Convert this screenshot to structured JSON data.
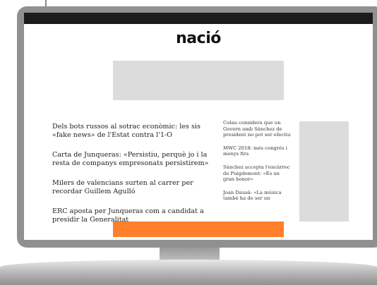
{
  "brand": {
    "logo_text": "nació"
  },
  "main_news": [
    {
      "headline": "Dels bots russos al sotrac econòmic: les sis «fake news» de l'Estat contra l'1-O"
    },
    {
      "headline": "Carta de Junqueras: «Persistiu, perquè jo i la resta de companys empresonats persistirem»"
    },
    {
      "headline": "Milers de valencians surten al carrer per recordar Guillem Agulló"
    },
    {
      "headline": "ERC aposta per Junqueras com a candidat a presidir la Generalitat"
    }
  ],
  "side_news": [
    {
      "headline": "Colau considera que un Govern amb Sànchez de president no pot ser efectiu"
    },
    {
      "headline": "MWC 2018: més congrés i menys fira"
    },
    {
      "headline": "Sànchez accepta l'encàrrec de Puigdemont: «És un gran honor»"
    },
    {
      "headline": "Joan Dausà: «La música també ha de ser un"
    }
  ],
  "colors": {
    "monitor_bezel": "#8f9191",
    "topbar": "#1c1c1c",
    "ad_placeholder": "#dcdcdc",
    "orange_banner": "#ff7f2a"
  }
}
